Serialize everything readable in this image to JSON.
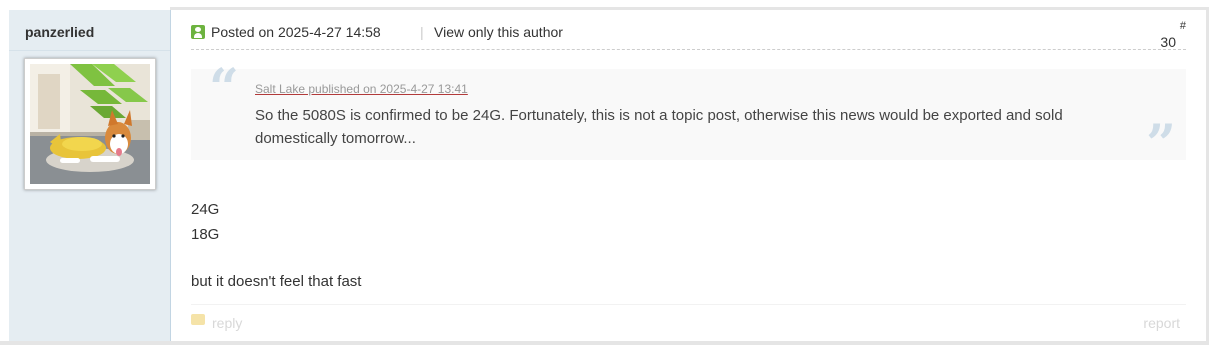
{
  "author": {
    "name": "panzerlied",
    "avatar_icon": "corgi-avatar-icon"
  },
  "post": {
    "posted": "Posted on 2025-4-27 14:58",
    "separator": "|",
    "view_only": "View only this author",
    "floor_hash": "#",
    "floor_number": "30",
    "quote": {
      "meta": "Salt Lake published on 2025-4-27 13:41",
      "text": "So the 5080S is confirmed to be 24G. Fortunately, this is not a topic post, otherwise this news would be exported and sold domestically tomorrow...",
      "open_mark": "“",
      "close_mark": "”"
    },
    "body": {
      "line1": "24G",
      "line2": "18G",
      "line3": "but it doesn't feel that fast"
    },
    "footer": {
      "reply": "reply",
      "report": "report"
    }
  },
  "colors": {
    "sidebar_bg": "#e5edf2",
    "quote_bg": "#f9f9f9",
    "online": "#6db33f"
  }
}
